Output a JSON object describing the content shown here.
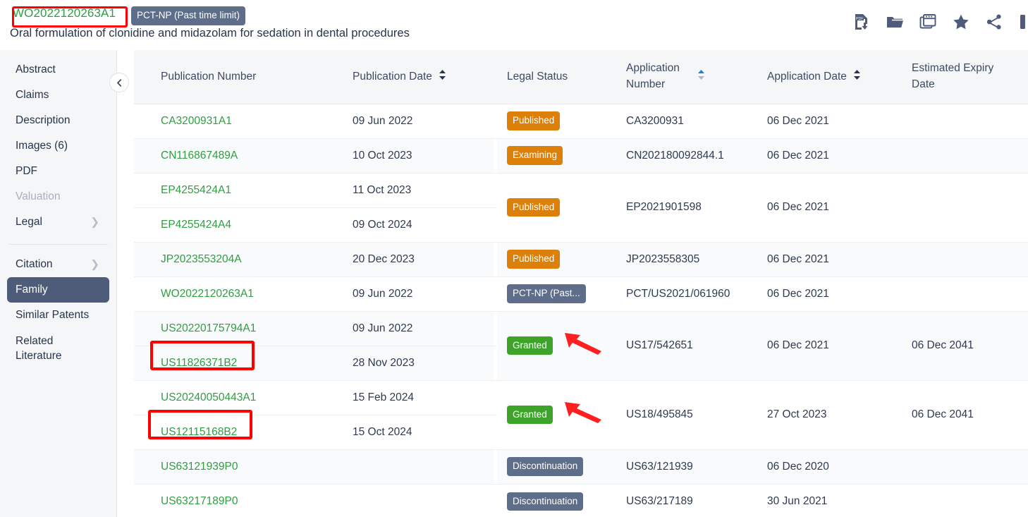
{
  "header": {
    "publication_number": "WO2022120263A1",
    "status_chip": "PCT-NP (Past time limit)",
    "title": "Oral formulation of clonidine and midazolam for sedation in dental procedures",
    "toolbar": [
      {
        "name": "pdf-download-icon",
        "label": "PDF Download"
      },
      {
        "name": "folder-icon",
        "label": "Folder"
      },
      {
        "name": "windows-icon",
        "label": "Windows"
      },
      {
        "name": "star-icon",
        "label": "Favorite"
      },
      {
        "name": "share-icon",
        "label": "Share"
      },
      {
        "name": "partial-icon",
        "label": ""
      }
    ]
  },
  "sidebar": {
    "collapse_icon": "chevron-left-icon",
    "items": [
      {
        "label": "Abstract",
        "state": "normal",
        "chevron": false
      },
      {
        "label": "Claims",
        "state": "normal",
        "chevron": false
      },
      {
        "label": "Description",
        "state": "normal",
        "chevron": false
      },
      {
        "label": "Images (6)",
        "state": "normal",
        "chevron": false
      },
      {
        "label": "PDF",
        "state": "normal",
        "chevron": false
      },
      {
        "label": "Valuation",
        "state": "disabled",
        "chevron": false
      },
      {
        "label": "Legal",
        "state": "normal",
        "chevron": true
      },
      {
        "label": "Citation",
        "state": "normal",
        "chevron": true
      },
      {
        "label": "Family",
        "state": "active",
        "chevron": false
      },
      {
        "label": "Similar Patents",
        "state": "normal",
        "chevron": false
      },
      {
        "label": "Related Literature",
        "state": "normal",
        "chevron": false
      }
    ]
  },
  "table": {
    "columns": [
      {
        "key": "publication_number",
        "label": "Publication Number",
        "sortable": false,
        "sort": "none"
      },
      {
        "key": "publication_date",
        "label": "Publication Date",
        "sortable": true,
        "sort": "none"
      },
      {
        "key": "legal_status",
        "label": "Legal Status",
        "sortable": false,
        "sort": "none"
      },
      {
        "key": "application_number",
        "label": "Application Number",
        "sortable": true,
        "sort": "asc"
      },
      {
        "key": "application_date",
        "label": "Application Date",
        "sortable": true,
        "sort": "none"
      },
      {
        "key": "estimated_expiry",
        "label": "Estimated Expiry Date",
        "sortable": false,
        "sort": "none"
      }
    ],
    "groups": [
      {
        "legal_status": "Published",
        "legal_color": "orange",
        "application_number": "CA3200931",
        "application_date": "06 Dec 2021",
        "estimated_expiry": "",
        "rows": [
          {
            "publication_number": "CA3200931A1",
            "publication_date": "09 Jun 2022",
            "tint": "white",
            "highlight": false
          }
        ]
      },
      {
        "legal_status": "Examining",
        "legal_color": "orange",
        "application_number": "CN202180092844.1",
        "application_date": "06 Dec 2021",
        "estimated_expiry": "",
        "rows": [
          {
            "publication_number": "CN116867489A",
            "publication_date": "10 Oct 2023",
            "tint": "tint",
            "highlight": false
          }
        ]
      },
      {
        "legal_status": "Published",
        "legal_color": "orange",
        "application_number": "EP2021901598",
        "application_date": "06 Dec 2021",
        "estimated_expiry": "",
        "rows": [
          {
            "publication_number": "EP4255424A1",
            "publication_date": "11 Oct 2023",
            "tint": "white",
            "highlight": false
          },
          {
            "publication_number": "EP4255424A4",
            "publication_date": "09 Oct 2024",
            "tint": "white",
            "highlight": false
          }
        ]
      },
      {
        "legal_status": "Published",
        "legal_color": "orange",
        "application_number": "JP2023558305",
        "application_date": "06 Dec 2021",
        "estimated_expiry": "",
        "rows": [
          {
            "publication_number": "JP2023553204A",
            "publication_date": "20 Dec 2023",
            "tint": "tint",
            "highlight": false
          }
        ]
      },
      {
        "legal_status": "PCT-NP (Past...",
        "legal_color": "gray",
        "application_number": "PCT/US2021/061960",
        "application_date": "06 Dec 2021",
        "estimated_expiry": "",
        "rows": [
          {
            "publication_number": "WO2022120263A1",
            "publication_date": "09 Jun 2022",
            "tint": "white",
            "highlight": false
          }
        ]
      },
      {
        "legal_status": "Granted",
        "legal_color": "green",
        "arrow": true,
        "application_number": "US17/542651",
        "application_date": "06 Dec 2021",
        "estimated_expiry": "06 Dec 2041",
        "rows": [
          {
            "publication_number": "US20220175794A1",
            "publication_date": "09 Jun 2022",
            "tint": "tint",
            "highlight": false
          },
          {
            "publication_number": "US11826371B2",
            "publication_date": "28 Nov 2023",
            "tint": "tint",
            "highlight": true
          }
        ]
      },
      {
        "legal_status": "Granted",
        "legal_color": "green",
        "arrow": true,
        "application_number": "US18/495845",
        "application_date": "27 Oct 2023",
        "estimated_expiry": "06 Dec 2041",
        "rows": [
          {
            "publication_number": "US20240050443A1",
            "publication_date": "15 Feb 2024",
            "tint": "white",
            "highlight": false
          },
          {
            "publication_number": "US12115168B2",
            "publication_date": "15 Oct 2024",
            "tint": "white",
            "highlight": true
          }
        ]
      },
      {
        "legal_status": "Discontinuation",
        "legal_color": "gray",
        "application_number": "US63/121939",
        "application_date": "06 Dec 2020",
        "estimated_expiry": "",
        "rows": [
          {
            "publication_number": "US63121939P0",
            "publication_date": "",
            "tint": "tint",
            "highlight": false
          }
        ]
      },
      {
        "legal_status": "Discontinuation",
        "legal_color": "gray",
        "application_number": "US63/217189",
        "application_date": "30 Jun 2021",
        "estimated_expiry": "",
        "rows": [
          {
            "publication_number": "US63217189P0",
            "publication_date": "",
            "tint": "white",
            "highlight": false
          }
        ]
      }
    ]
  },
  "annotations": {
    "highlight_color": "#fe0000",
    "boxes": [
      "WO2022120263A1",
      "US11826371B2",
      "US12115168B2"
    ],
    "arrows": [
      "Granted (US17/542651)",
      "Granted (US18/495845)"
    ]
  }
}
